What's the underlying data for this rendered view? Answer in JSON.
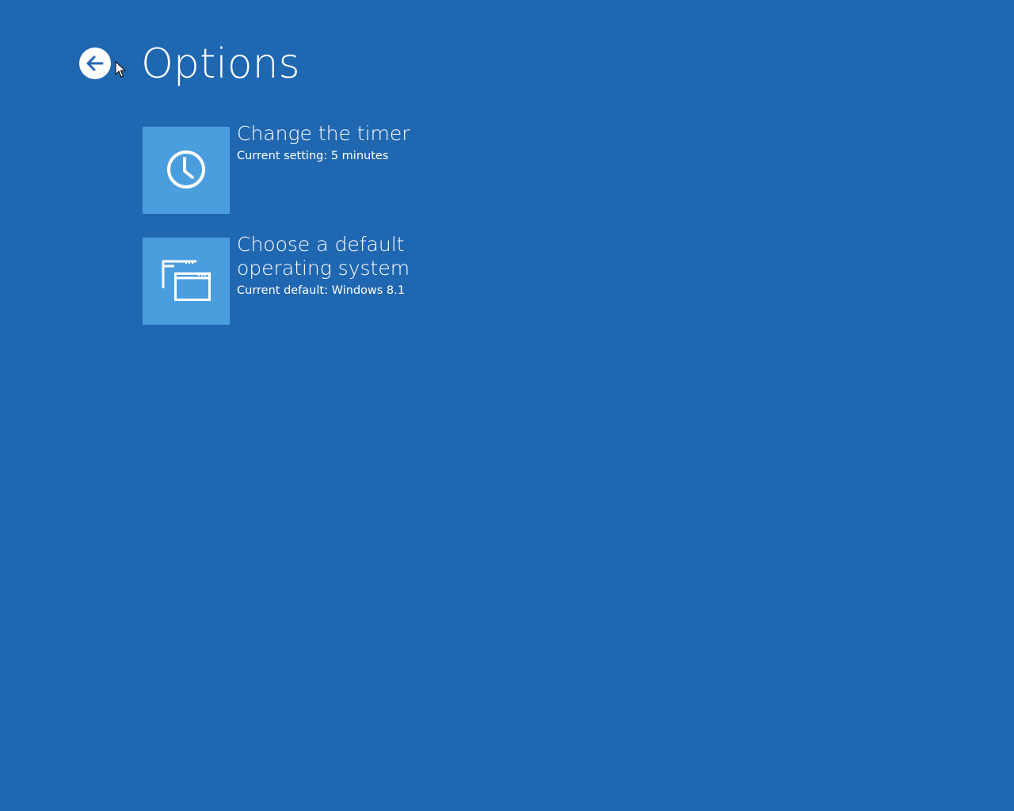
{
  "page": {
    "title": "Options",
    "background_color": "#2067b1",
    "tile_color": "#4a9ede"
  },
  "back_button": {
    "icon": "arrow-left-icon"
  },
  "options": [
    {
      "icon": "clock-icon",
      "title_lines": [
        "Change the timer"
      ],
      "subtitle": "Current setting: 5 minutes"
    },
    {
      "icon": "windows-stack-icon",
      "title_lines": [
        "Choose a default",
        "operating system"
      ],
      "subtitle": "Current default: Windows 8.1"
    }
  ]
}
